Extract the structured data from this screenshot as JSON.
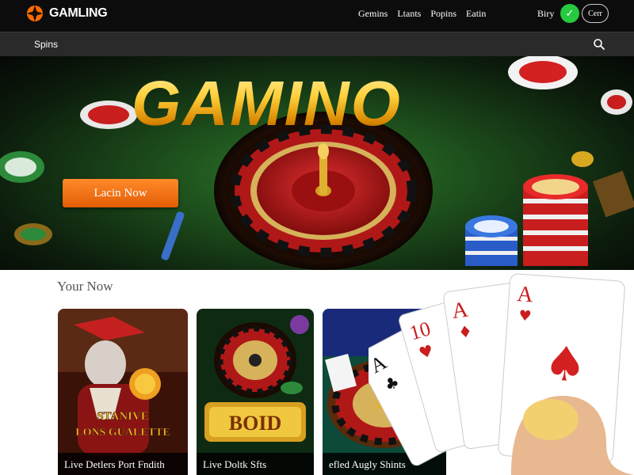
{
  "header": {
    "logo_text": "GAMLING",
    "nav": [
      "Gemins",
      "Ltants",
      "Popins",
      "Eatin"
    ],
    "buy_label": "Biry",
    "account_button_label": "Cerr",
    "check_icon": "check-icon"
  },
  "subnav": {
    "label": "Spins",
    "search_icon": "search-icon"
  },
  "hero": {
    "title": "GAMINO",
    "cta_label": "Lacin Now"
  },
  "section": {
    "title": "Your Now"
  },
  "cards": [
    {
      "art_text": "STANIVE",
      "art_text2": "LONS GUALETTE",
      "caption": "Live Detlers Port Fndith"
    },
    {
      "art_text": "BOID",
      "caption": "Live Doltk Sfts"
    },
    {
      "caption": "efled Augly Shints"
    }
  ],
  "playing_cards": [
    "A",
    "10",
    "A",
    "A"
  ],
  "colors": {
    "accent": "#e35d06",
    "gold": "#ffcf3a",
    "green": "#27c93f"
  }
}
